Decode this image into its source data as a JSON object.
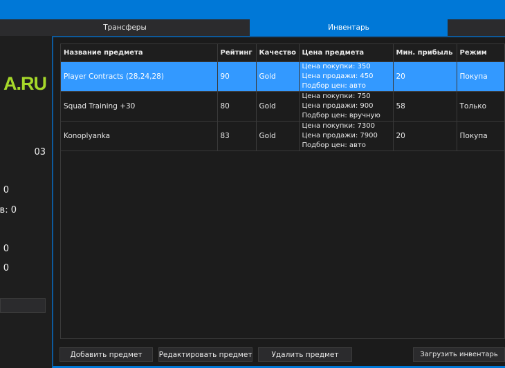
{
  "tabs": [
    {
      "label": "Трансферы"
    },
    {
      "label": "Инвентарь",
      "active": true
    },
    {
      "label": ""
    }
  ],
  "left_panel": {
    "logo": "A.RU",
    "stats": [
      "03",
      "0",
      "в: 0",
      "0",
      "0"
    ]
  },
  "table": {
    "headers": [
      "Название предмета",
      "Рейтинг",
      "Качество",
      "Цена предмета",
      "Мин. прибыль",
      "Режим"
    ],
    "rows": [
      {
        "name": "Player Contracts (28,24,28)",
        "rating": "90",
        "quality": "Gold",
        "buy": "Цена покупки: 350",
        "sell": "Цена продажи: 450",
        "pricing": "Подбор цен: авто",
        "min_profit": "20",
        "mode": "Покупа",
        "selected": true
      },
      {
        "name": "Squad Training +30",
        "rating": "80",
        "quality": "Gold",
        "buy": "Цена покупки: 750",
        "sell": "Цена продажи: 900",
        "pricing": "Подбор цен: вручную",
        "min_profit": "58",
        "mode": "Только"
      },
      {
        "name": "Konoplyanka",
        "rating": "83",
        "quality": "Gold",
        "buy": "Цена покупки: 7300",
        "sell": "Цена продажи: 7900",
        "pricing": "Подбор цен: авто",
        "min_profit": "20",
        "mode": "Покупа"
      }
    ]
  },
  "buttons": {
    "add": "Добавить предмет",
    "edit": "Редактировать предмет",
    "delete": "Удалить предмет",
    "load": "Загрузить инвентарь"
  },
  "colors": {
    "accent": "#0078d7",
    "selection": "#3399ff",
    "logo": "#a6d82a"
  }
}
